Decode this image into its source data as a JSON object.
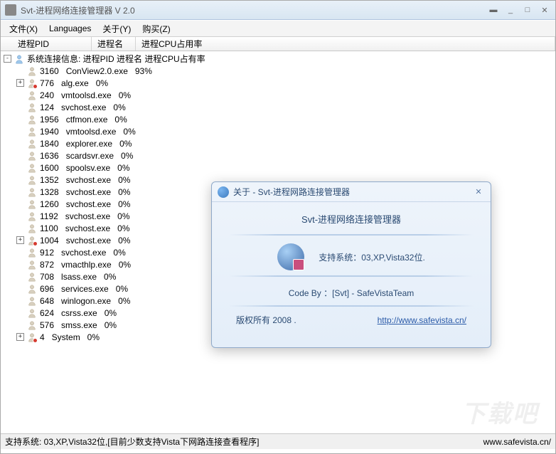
{
  "window": {
    "title": "Svt-进程网络连接管理器 V 2.0"
  },
  "menu": {
    "file": "文件(X)",
    "languages": "Languages",
    "about": "关于(Y)",
    "buy": "购买(Z)"
  },
  "columns": {
    "pid": "进程PID",
    "name": "进程名",
    "cpu": "进程CPU占用率"
  },
  "tree": {
    "root_label": "系统连接信息: 进程PID 进程名 进程CPU占有率",
    "rows": [
      {
        "pid": 3160,
        "name": "ConView2.0.exe",
        "cpu": "93%",
        "expander": "",
        "badge": false,
        "indent": 1
      },
      {
        "pid": 776,
        "name": "alg.exe",
        "cpu": "0%",
        "expander": "+",
        "badge": true,
        "indent": 1
      },
      {
        "pid": 240,
        "name": "vmtoolsd.exe",
        "cpu": "0%",
        "expander": "",
        "badge": false,
        "indent": 1
      },
      {
        "pid": 124,
        "name": "svchost.exe",
        "cpu": "0%",
        "expander": "",
        "badge": false,
        "indent": 1
      },
      {
        "pid": 1956,
        "name": "ctfmon.exe",
        "cpu": "0%",
        "expander": "",
        "badge": false,
        "indent": 1
      },
      {
        "pid": 1940,
        "name": "vmtoolsd.exe",
        "cpu": "0%",
        "expander": "",
        "badge": false,
        "indent": 1
      },
      {
        "pid": 1840,
        "name": "explorer.exe",
        "cpu": "0%",
        "expander": "",
        "badge": false,
        "indent": 1
      },
      {
        "pid": 1636,
        "name": "scardsvr.exe",
        "cpu": "0%",
        "expander": "",
        "badge": false,
        "indent": 1
      },
      {
        "pid": 1600,
        "name": "spoolsv.exe",
        "cpu": "0%",
        "expander": "",
        "badge": false,
        "indent": 1
      },
      {
        "pid": 1352,
        "name": "svchost.exe",
        "cpu": "0%",
        "expander": "",
        "badge": false,
        "indent": 1
      },
      {
        "pid": 1328,
        "name": "svchost.exe",
        "cpu": "0%",
        "expander": "",
        "badge": false,
        "indent": 1
      },
      {
        "pid": 1260,
        "name": "svchost.exe",
        "cpu": "0%",
        "expander": "",
        "badge": false,
        "indent": 1
      },
      {
        "pid": 1192,
        "name": "svchost.exe",
        "cpu": "0%",
        "expander": "",
        "badge": false,
        "indent": 1
      },
      {
        "pid": 1100,
        "name": "svchost.exe",
        "cpu": "0%",
        "expander": "",
        "badge": false,
        "indent": 1
      },
      {
        "pid": 1004,
        "name": "svchost.exe",
        "cpu": "0%",
        "expander": "+",
        "badge": true,
        "indent": 1
      },
      {
        "pid": 912,
        "name": "svchost.exe",
        "cpu": "0%",
        "expander": "",
        "badge": false,
        "indent": 1
      },
      {
        "pid": 872,
        "name": "vmacthlp.exe",
        "cpu": "0%",
        "expander": "",
        "badge": false,
        "indent": 1
      },
      {
        "pid": 708,
        "name": "lsass.exe",
        "cpu": "0%",
        "expander": "",
        "badge": false,
        "indent": 1
      },
      {
        "pid": 696,
        "name": "services.exe",
        "cpu": "0%",
        "expander": "",
        "badge": false,
        "indent": 1
      },
      {
        "pid": 648,
        "name": "winlogon.exe",
        "cpu": "0%",
        "expander": "",
        "badge": false,
        "indent": 1
      },
      {
        "pid": 624,
        "name": "csrss.exe",
        "cpu": "0%",
        "expander": "",
        "badge": false,
        "indent": 1
      },
      {
        "pid": 576,
        "name": "smss.exe",
        "cpu": "0%",
        "expander": "",
        "badge": false,
        "indent": 1
      },
      {
        "pid": 4,
        "name": "System",
        "cpu": "0%",
        "expander": "+",
        "badge": true,
        "indent": 1
      }
    ]
  },
  "status": {
    "left": "支持系统: 03,XP,Vista32位,[目前少数支持Vista下网路连接查看程序]",
    "right": "www.safevista.cn/"
  },
  "dialog": {
    "title": "关于 - Svt-进程网路连接管理器",
    "heading": "Svt-进程网络连接管理器",
    "support": "支持系统：03,XP,Vista32位.",
    "codeby": "Code By ：[Svt] - SafeVistaTeam",
    "copyright": "版权所有 2008 .",
    "link": "http://www.safevista.cn/"
  },
  "watermark": "下载吧"
}
